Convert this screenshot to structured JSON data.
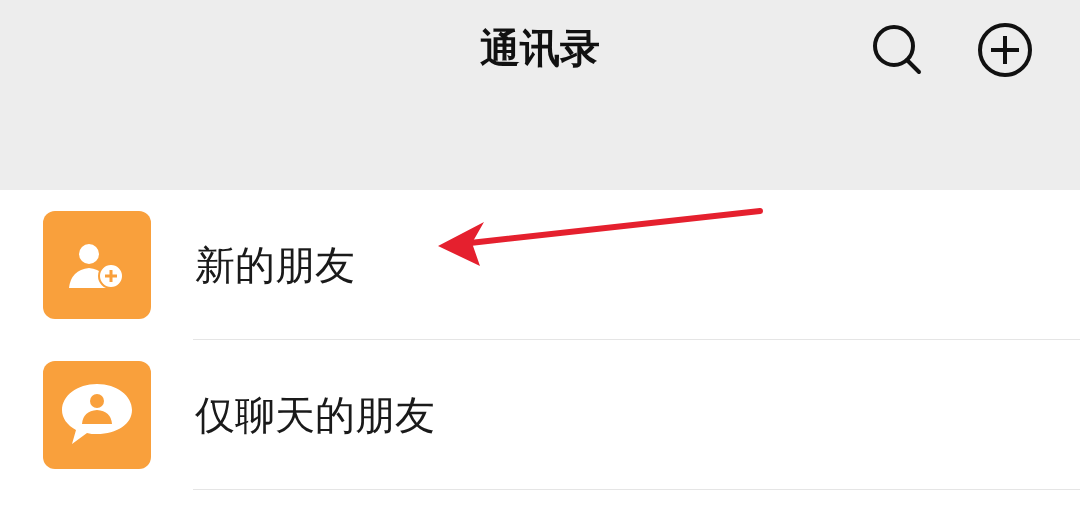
{
  "header": {
    "title": "通讯录"
  },
  "items": [
    {
      "kind": "new-friend",
      "label": "新的朋友"
    },
    {
      "kind": "chat-only",
      "label": "仅聊天的朋友"
    }
  ]
}
